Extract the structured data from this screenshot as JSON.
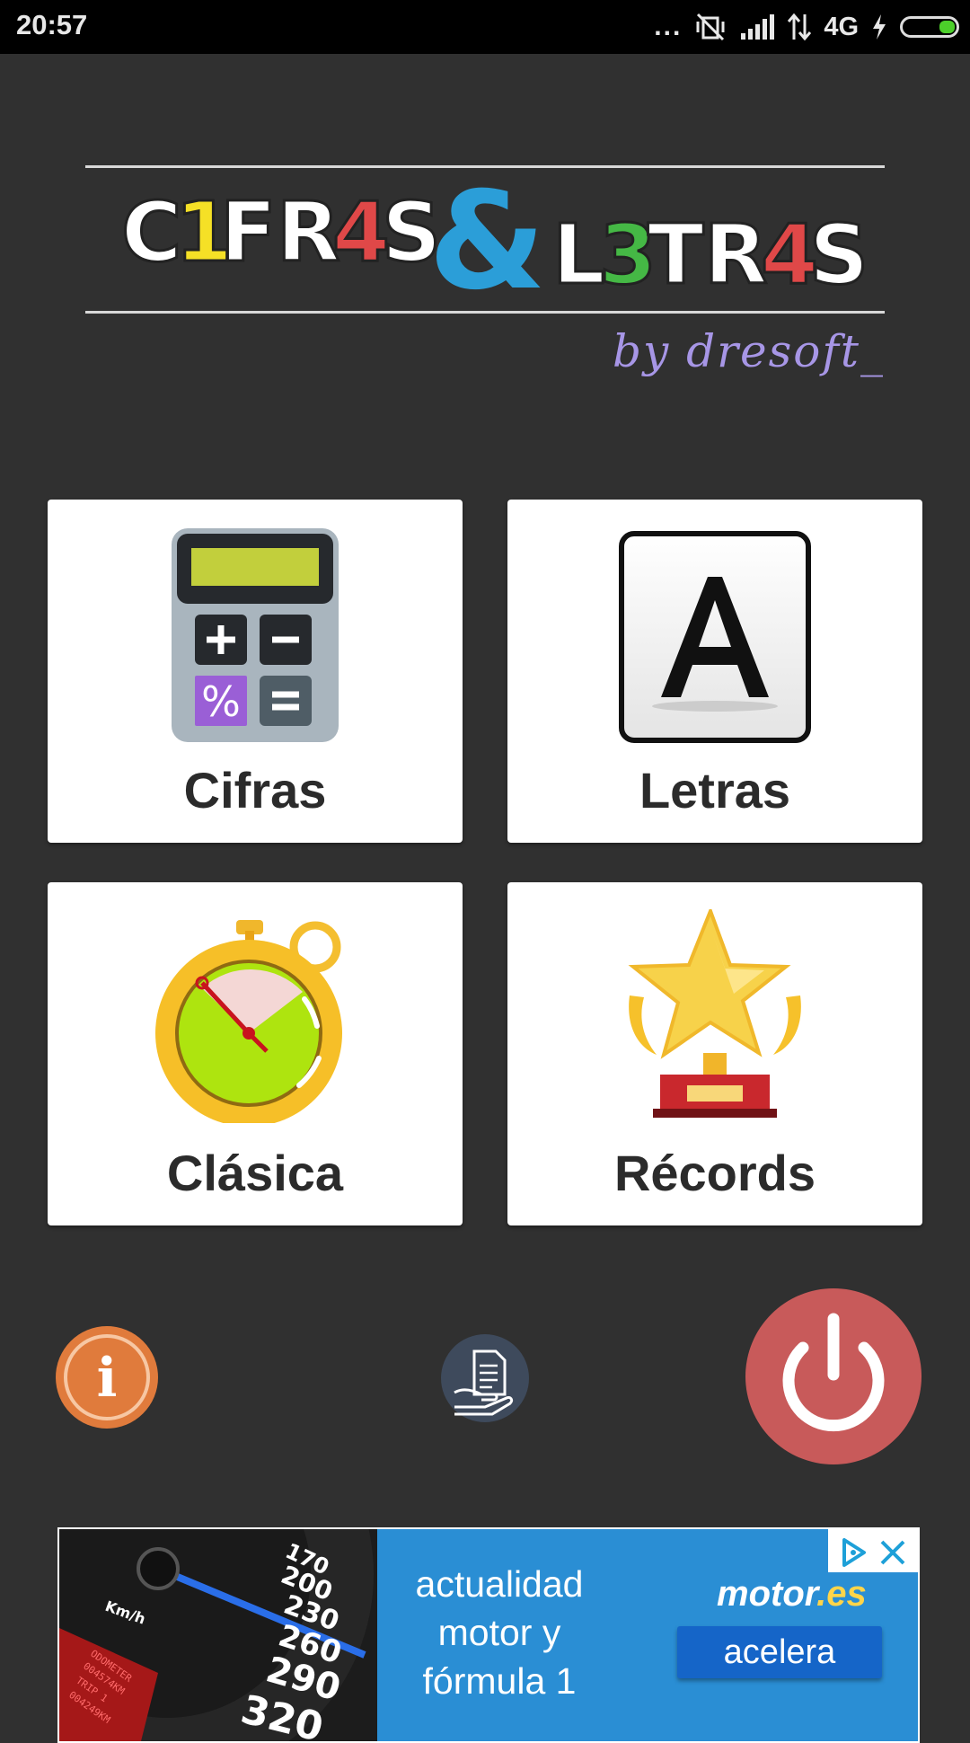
{
  "status_bar": {
    "time": "20:57",
    "dots": "...",
    "network": "4G",
    "battery_level_fraction": 0.3,
    "icons": [
      "more-dots-icon",
      "vibrate-off-icon",
      "signal-icon",
      "data-transfer-icon",
      "charging-icon",
      "battery-icon"
    ]
  },
  "header": {
    "logo_text": "C1FR4S & L3TR4S",
    "byline": "by dresoft_",
    "colors": {
      "accent_yellow": "#f5e026",
      "accent_red": "#e04848",
      "accent_blue": "#2b9ed8",
      "accent_green": "#45b845",
      "byline": "#a796e6"
    }
  },
  "menu": {
    "cifras": {
      "label": "Cifras",
      "icon": "calculator-icon"
    },
    "letras": {
      "label": "Letras",
      "icon": "letter-a-icon"
    },
    "clasica": {
      "label": "Clásica",
      "icon": "stopwatch-icon"
    },
    "records": {
      "label": "Récords",
      "icon": "trophy-icon"
    }
  },
  "actions": {
    "info": {
      "icon": "info-icon",
      "glyph": "i",
      "color": "#e07b3c"
    },
    "donate": {
      "icon": "document-hand-icon",
      "color": "#3e4a5c"
    },
    "power": {
      "icon": "power-icon",
      "color": "#c85a5a"
    }
  },
  "ad": {
    "text_line1": "actualidad",
    "text_line2": "motor y",
    "text_line3": "fórmula 1",
    "brand_main": "motor",
    "brand_suffix": ".es",
    "cta": "acelera",
    "speedo_ticks": [
      "170",
      "200",
      "230",
      "260",
      "290",
      "320"
    ],
    "speedo_unit": "Km/h",
    "odometer": [
      "ODOMETER",
      "004574KM",
      "TRIP 1",
      "004249KM"
    ],
    "icons": [
      "ad-choices-icon",
      "close-icon"
    ]
  }
}
